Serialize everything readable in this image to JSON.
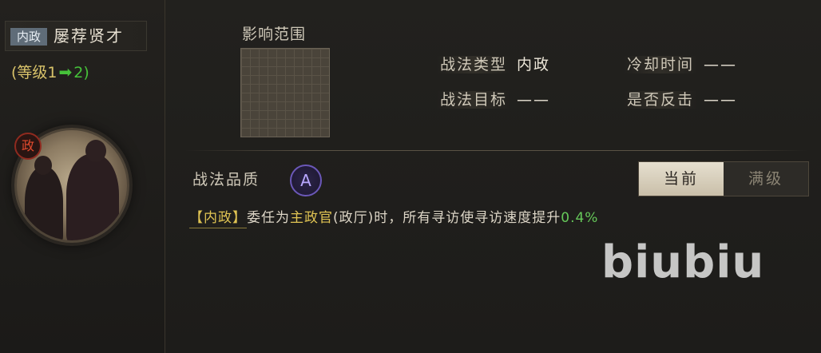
{
  "skill": {
    "type_tag": "内政",
    "name": "屡荐贤才",
    "level_from_text": "(等级1",
    "level_arrow": "➡",
    "level_to_text": "2)"
  },
  "portrait": {
    "badge": "政"
  },
  "range": {
    "label": "影响范围"
  },
  "attributes": {
    "type_label": "战法类型",
    "type_value": "内政",
    "cooldown_label": "冷却时间",
    "cooldown_value": "——",
    "target_label": "战法目标",
    "target_value": "——",
    "counter_label": "是否反击",
    "counter_value": "——"
  },
  "quality": {
    "label": "战法品质",
    "grade": "A"
  },
  "toggle": {
    "current": "当前",
    "max": "满级"
  },
  "description": {
    "tag": "【内政】",
    "part1": "委任为",
    "role": "主政官",
    "part2": "(政厅)时，所有寻访使寻访速度提升",
    "value": "0.4%"
  },
  "watermark": "biubiu",
  "colors": {
    "accent_yellow": "#e0c453",
    "accent_green": "#46c23a",
    "quality_purple": "#6b58b8",
    "gov_red": "#e24a2d"
  }
}
